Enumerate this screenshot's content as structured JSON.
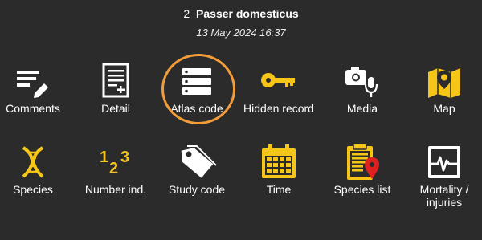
{
  "header": {
    "count": "2",
    "species": "Passer domesticus",
    "datetime": "13 May 2024 16:37"
  },
  "tiles": [
    {
      "label": "Comments",
      "icon": "comments-edit-icon"
    },
    {
      "label": "Detail",
      "icon": "document-add-icon"
    },
    {
      "label": "Atlas code",
      "icon": "list-layers-icon"
    },
    {
      "label": "Hidden record",
      "icon": "key-icon"
    },
    {
      "label": "Media",
      "icon": "camera-microphone-icon"
    },
    {
      "label": "Map",
      "icon": "map-pin-icon"
    },
    {
      "label": "Species",
      "icon": "dna-icon"
    },
    {
      "label": "Number ind.",
      "icon": "numbers-123-icon"
    },
    {
      "label": "Study code",
      "icon": "tag-icon"
    },
    {
      "label": "Time",
      "icon": "calendar-icon"
    },
    {
      "label": "Species list",
      "icon": "clipboard-pin-icon"
    },
    {
      "label": "Mortality / injuries",
      "icon": "heartbeat-monitor-icon"
    }
  ],
  "colors": {
    "background": "#2b2b2b",
    "accent": "#f5c518",
    "highlight_ring": "#f39c3a",
    "pin_red": "#e02020",
    "text": "#ffffff"
  }
}
